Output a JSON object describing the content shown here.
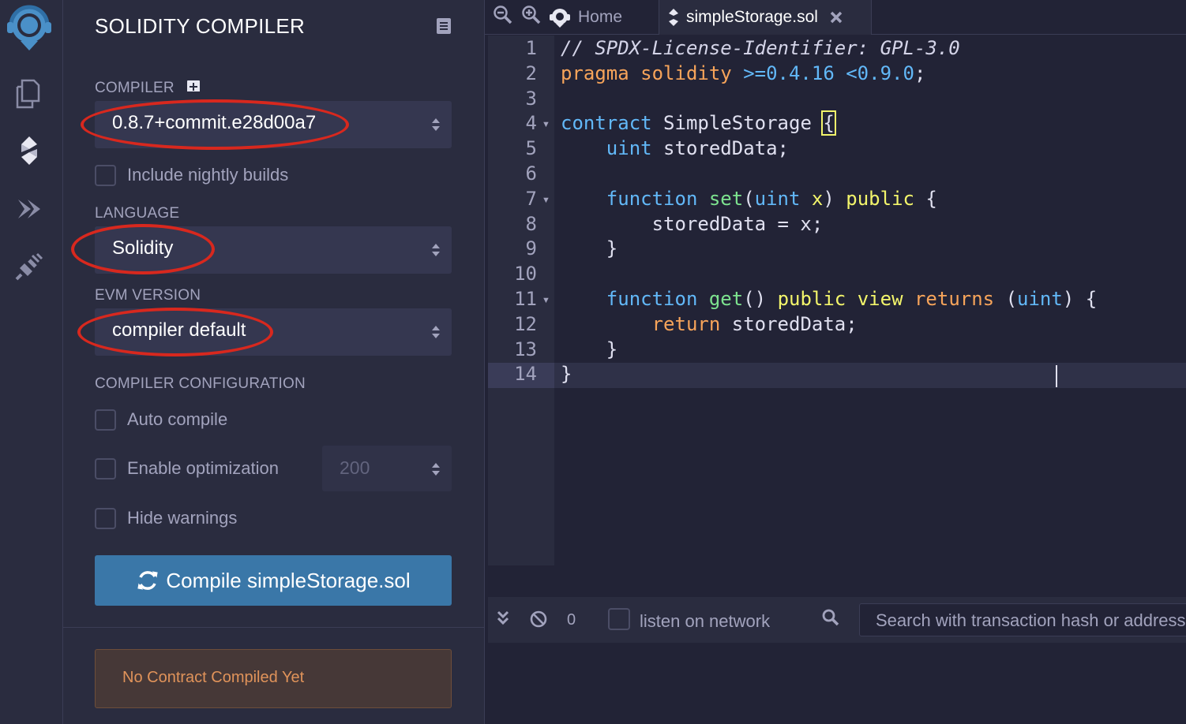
{
  "side_panel": {
    "title": "SOLIDITY COMPILER",
    "compiler_label": "COMPILER",
    "compiler_value": "0.8.7+commit.e28d00a7",
    "nightly_label": "Include nightly builds",
    "language_label": "LANGUAGE",
    "language_value": "Solidity",
    "evm_label": "EVM VERSION",
    "evm_value": "compiler default",
    "config_label": "COMPILER CONFIGURATION",
    "auto_compile_label": "Auto compile",
    "optimization_label": "Enable optimization",
    "optimization_runs": "200",
    "hide_warnings_label": "Hide warnings",
    "compile_button": "Compile simpleStorage.sol",
    "status_message": "No Contract Compiled Yet"
  },
  "tabs": {
    "home": "Home",
    "file": "simpleStorage.sol"
  },
  "editor": {
    "line_numbers": [
      "1",
      "2",
      "3",
      "4",
      "5",
      "6",
      "7",
      "8",
      "9",
      "10",
      "11",
      "12",
      "13",
      "14"
    ],
    "lines": [
      [
        {
          "t": "// SPDX-License-Identifier: GPL-3.0",
          "c": "c-comment"
        }
      ],
      [
        {
          "t": "pragma solidity ",
          "c": "c-kw-orange"
        },
        {
          "t": ">=0.4.16 <0.9.0",
          "c": "c-kw-blue"
        },
        {
          "t": ";",
          "c": "c-plain"
        }
      ],
      [],
      [
        {
          "t": "contract ",
          "c": "c-kw-blue"
        },
        {
          "t": "SimpleStorage ",
          "c": "c-plain"
        },
        {
          "t": "{",
          "c": "c-plain bracket-hl"
        }
      ],
      [
        {
          "t": "    uint ",
          "c": "c-kw-blue"
        },
        {
          "t": "storedData;",
          "c": "c-plain"
        }
      ],
      [],
      [
        {
          "t": "    function ",
          "c": "c-kw-blue"
        },
        {
          "t": "set",
          "c": "c-kw-green"
        },
        {
          "t": "(",
          "c": "c-plain"
        },
        {
          "t": "uint ",
          "c": "c-kw-blue"
        },
        {
          "t": "x",
          "c": "c-kw-yellow"
        },
        {
          "t": ") ",
          "c": "c-plain"
        },
        {
          "t": "public ",
          "c": "c-kw-yellow"
        },
        {
          "t": "{",
          "c": "c-plain"
        }
      ],
      [
        {
          "t": "        storedData = x;",
          "c": "c-plain"
        }
      ],
      [
        {
          "t": "    }",
          "c": "c-plain"
        }
      ],
      [],
      [
        {
          "t": "    function ",
          "c": "c-kw-blue"
        },
        {
          "t": "get",
          "c": "c-kw-green"
        },
        {
          "t": "() ",
          "c": "c-plain"
        },
        {
          "t": "public ",
          "c": "c-kw-yellow"
        },
        {
          "t": "view ",
          "c": "c-kw-yellow"
        },
        {
          "t": "returns ",
          "c": "c-kw-orange"
        },
        {
          "t": "(",
          "c": "c-plain"
        },
        {
          "t": "uint",
          "c": "c-kw-blue"
        },
        {
          "t": ") {",
          "c": "c-plain"
        }
      ],
      [
        {
          "t": "        return ",
          "c": "c-kw-orange"
        },
        {
          "t": "storedData;",
          "c": "c-plain"
        }
      ],
      [
        {
          "t": "    }",
          "c": "c-plain"
        }
      ],
      [
        {
          "t": "}",
          "c": "c-plain"
        }
      ]
    ],
    "fold_lines": [
      4,
      7,
      11
    ]
  },
  "terminal": {
    "count": "0",
    "listen_label": "listen on network",
    "search_placeholder": "Search with transaction hash or address"
  },
  "icons": {
    "rail": [
      "remix-logo-icon",
      "file-explorer-icon",
      "solidity-compiler-icon",
      "deploy-run-icon",
      "plugin-manager-icon"
    ]
  },
  "colors": {
    "accent": "#3a77a8",
    "highlight_ring": "#d8281e",
    "warning_text": "#e0935a"
  }
}
